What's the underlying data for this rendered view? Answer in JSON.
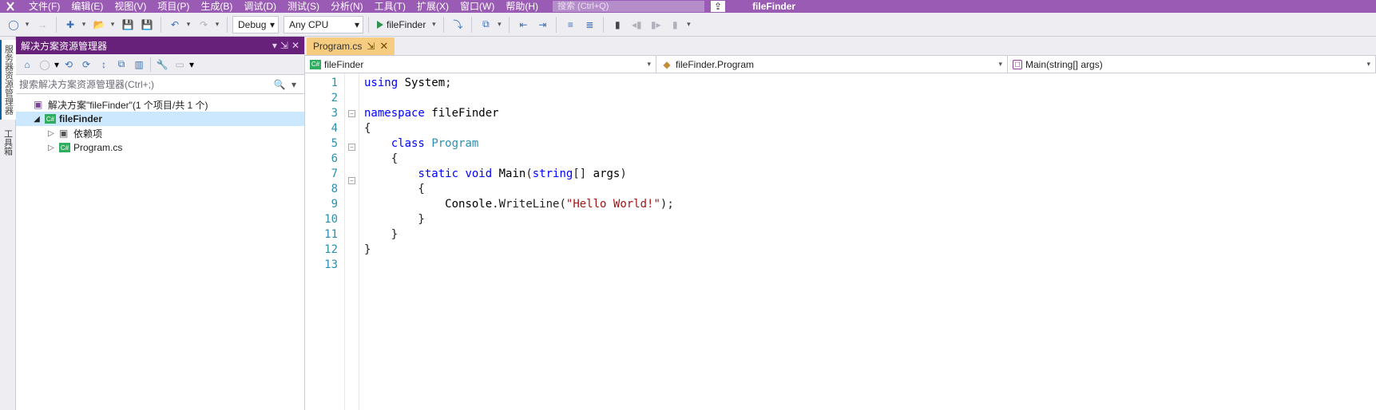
{
  "menu": {
    "items": [
      "文件(F)",
      "编辑(E)",
      "视图(V)",
      "项目(P)",
      "生成(B)",
      "调试(D)",
      "测试(S)",
      "分析(N)",
      "工具(T)",
      "扩展(X)",
      "窗口(W)",
      "帮助(H)"
    ],
    "search_placeholder": "搜索 (Ctrl+Q)",
    "config_name": "fileFinder"
  },
  "toolbar": {
    "config": "Debug",
    "platform": "Any CPU",
    "run_target": "fileFinder"
  },
  "left_tabs": [
    "服务器资源管理器",
    "工具箱"
  ],
  "sln": {
    "title": "解决方案资源管理器",
    "search_placeholder": "搜索解决方案资源管理器(Ctrl+;)",
    "root": "解决方案\"fileFinder\"(1 个项目/共 1 个)",
    "project": "fileFinder",
    "dependencies": "依赖项",
    "program": "Program.cs"
  },
  "editor": {
    "tab": "Program.cs",
    "crumbs": {
      "project": "fileFinder",
      "class": "fileFinder.Program",
      "method": "Main(string[] args)"
    },
    "lines": [
      {
        "n": 1,
        "tokens": [
          [
            "kw",
            "using"
          ],
          [
            "",
            " "
          ],
          [
            "id",
            "System"
          ],
          [
            "",
            ";"
          ]
        ]
      },
      {
        "n": 2,
        "tokens": []
      },
      {
        "n": 3,
        "tokens": [
          [
            "kw",
            "namespace"
          ],
          [
            "",
            " "
          ],
          [
            "id",
            "fileFinder"
          ]
        ],
        "fold": "open"
      },
      {
        "n": 4,
        "tokens": [
          [
            "",
            "{"
          ]
        ]
      },
      {
        "n": 5,
        "tokens": [
          [
            "",
            "    "
          ],
          [
            "kw",
            "class"
          ],
          [
            "",
            " "
          ],
          [
            "typ",
            "Program"
          ]
        ],
        "fold": "open"
      },
      {
        "n": 6,
        "tokens": [
          [
            "",
            "    {"
          ]
        ]
      },
      {
        "n": 7,
        "tokens": [
          [
            "",
            "        "
          ],
          [
            "kw",
            "static"
          ],
          [
            "",
            " "
          ],
          [
            "kw",
            "void"
          ],
          [
            "",
            " "
          ],
          [
            "id",
            "Main"
          ],
          [
            "",
            "("
          ],
          [
            "kw",
            "string"
          ],
          [
            "",
            "[] "
          ],
          [
            "id",
            "args"
          ],
          [
            "",
            ")"
          ]
        ],
        "fold": "open"
      },
      {
        "n": 8,
        "tokens": [
          [
            "",
            "        {"
          ]
        ]
      },
      {
        "n": 9,
        "tokens": [
          [
            "",
            "            "
          ],
          [
            "id",
            "Console"
          ],
          [
            "",
            ".WriteLine("
          ],
          [
            "str",
            "\"Hello World!\""
          ],
          [
            "",
            ");"
          ]
        ]
      },
      {
        "n": 10,
        "tokens": [
          [
            "",
            "        }"
          ]
        ]
      },
      {
        "n": 11,
        "tokens": [
          [
            "",
            "    }"
          ]
        ]
      },
      {
        "n": 12,
        "tokens": [
          [
            "",
            "}"
          ]
        ]
      },
      {
        "n": 13,
        "tokens": []
      }
    ]
  }
}
